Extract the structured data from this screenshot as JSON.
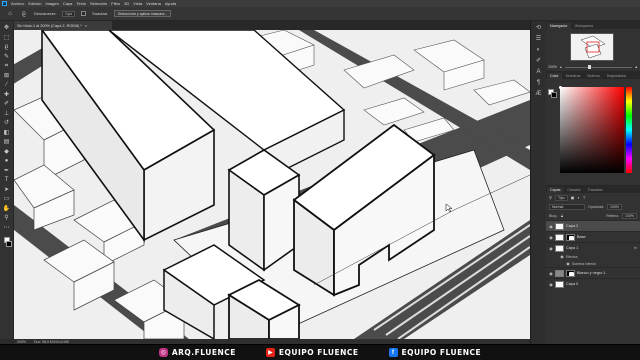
{
  "app": {
    "menu": [
      "Archivo",
      "Edición",
      "Imagen",
      "Capa",
      "Texto",
      "Selección",
      "Filtro",
      "3D",
      "Vista",
      "Ventana",
      "Ayuda"
    ]
  },
  "options_bar": {
    "feather_label": "Desvanecer:",
    "feather_value": "0 px",
    "antialias_label": "Suavizar",
    "select_mask_button": "Seleccionar y aplicar máscara..."
  },
  "document": {
    "tab_title": "Sin título-1 al 200% (Capa 2, RGB/8) *",
    "zoom": "200%",
    "doc_info": "Doc: 98,9 M/204,6 MB"
  },
  "panels": {
    "navigator_tabs": [
      "Navegador",
      "Histograma"
    ],
    "navigator_zoom": "200%",
    "navigator_zoom_fraction": 0.35,
    "color_tabs": [
      "Color",
      "Muestras",
      "Motivos",
      "Degradados"
    ],
    "color": {
      "foreground": "#ffffff",
      "background": "#000000",
      "hue": "#ff0000"
    },
    "layers_tabs": [
      "Capas",
      "Canales",
      "Trazados"
    ],
    "layers": {
      "filter_label": "Tipo",
      "blend_mode": "Normal",
      "opacity_label": "Opacidad:",
      "opacity_value": "100%",
      "lock_label": "Bloq.:",
      "fill_label": "Relleno:",
      "fill_value": "100%",
      "items": [
        {
          "name": "Capa 2",
          "selected": true,
          "has_mask": false
        },
        {
          "name": "Base",
          "selected": false,
          "has_mask": true
        },
        {
          "name": "Capa 1",
          "selected": false,
          "has_mask": false,
          "fx": "fx"
        },
        {
          "name": "Capa 0",
          "selected": false,
          "has_mask": false
        }
      ],
      "effects_label": "Efectos",
      "effect_item": "Sombra interior",
      "adjust_layer": "Blanco y negro 1"
    }
  },
  "branding": {
    "instagram": "ARQ.FLUENCE",
    "youtube": "EQUIPO FLUENCE",
    "facebook": "EQUIPO FLUENCE"
  },
  "icons": {
    "tools": [
      "move-icon",
      "marquee-icon",
      "lasso-icon",
      "quick-select-icon",
      "crop-icon",
      "frame-icon",
      "eyedropper-icon",
      "healing-icon",
      "brush-icon",
      "stamp-icon",
      "history-brush-icon",
      "eraser-icon",
      "gradient-icon",
      "blur-icon",
      "dodge-icon",
      "pen-icon",
      "type-icon",
      "path-select-icon",
      "shape-icon",
      "hand-icon",
      "zoom-icon"
    ]
  }
}
